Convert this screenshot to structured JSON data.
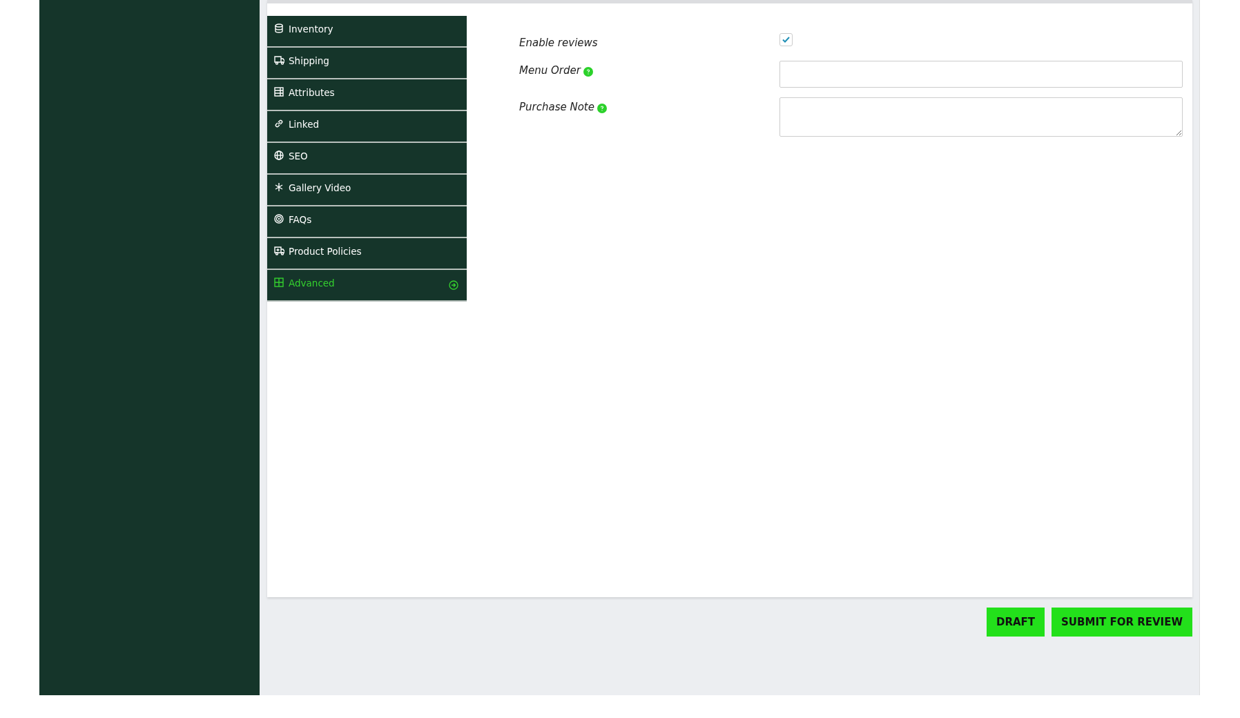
{
  "tabs": [
    {
      "label": "Inventory",
      "selected": false
    },
    {
      "label": "Shipping",
      "selected": false
    },
    {
      "label": "Attributes",
      "selected": false
    },
    {
      "label": "Linked",
      "selected": false
    },
    {
      "label": "SEO",
      "selected": false
    },
    {
      "label": "Gallery Video",
      "selected": false
    },
    {
      "label": "FAQs",
      "selected": false
    },
    {
      "label": "Product Policies",
      "selected": false
    },
    {
      "label": "Advanced",
      "selected": true
    }
  ],
  "fields": [
    {
      "kind": "checkbox",
      "label": "Enable reviews",
      "checked": true,
      "help": false
    },
    {
      "kind": "input",
      "label": "Menu Order",
      "help": true
    },
    {
      "kind": "textarea",
      "label": "Purchase Note",
      "help": true
    }
  ],
  "buttons": [
    {
      "label": "DRAFT"
    },
    {
      "label": "SUBMIT FOR REVIEW"
    }
  ]
}
